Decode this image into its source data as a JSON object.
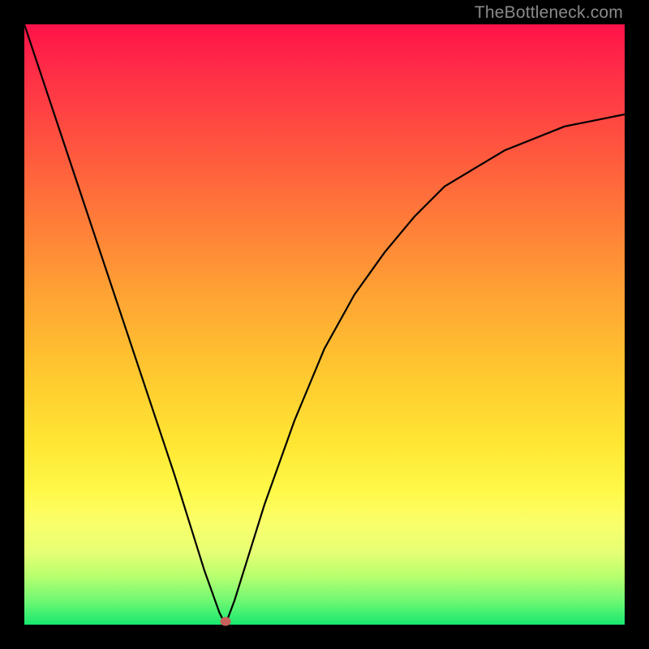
{
  "watermark": "TheBottleneck.com",
  "colors": {
    "black_frame": "#000000",
    "curve_stroke": "#000000",
    "marker_fill": "#c9605b",
    "gradient_stops": [
      "#ff1249",
      "#ff2e47",
      "#ff5a3e",
      "#ff8038",
      "#ffa634",
      "#ffc82f",
      "#ffe733",
      "#fff94a",
      "#faff6a",
      "#e6ff74",
      "#b6ff6e",
      "#70f873",
      "#17e96f"
    ]
  },
  "chart_data": {
    "type": "line",
    "title": "",
    "xlabel": "",
    "ylabel": "",
    "xlim": [
      0,
      1
    ],
    "ylim": [
      0,
      1
    ],
    "note": "Axes are unlabeled in the source image; x and y are normalized 0–1 across the plot area. The curve is a steep V reaching 0 near x≈0.33, with a gentler asymptotic rise on the right side.",
    "series": [
      {
        "name": "bottleneck-curve",
        "x": [
          0.0,
          0.05,
          0.1,
          0.15,
          0.2,
          0.25,
          0.3,
          0.325,
          0.335,
          0.35,
          0.4,
          0.45,
          0.5,
          0.55,
          0.6,
          0.65,
          0.7,
          0.75,
          0.8,
          0.85,
          0.9,
          0.95,
          1.0
        ],
        "y": [
          1.0,
          0.85,
          0.7,
          0.55,
          0.4,
          0.25,
          0.09,
          0.02,
          0.0,
          0.04,
          0.2,
          0.34,
          0.46,
          0.55,
          0.62,
          0.68,
          0.73,
          0.76,
          0.79,
          0.81,
          0.83,
          0.84,
          0.85
        ]
      }
    ],
    "markers": [
      {
        "name": "minimum-point",
        "x": 0.335,
        "y": 0.005
      }
    ]
  }
}
